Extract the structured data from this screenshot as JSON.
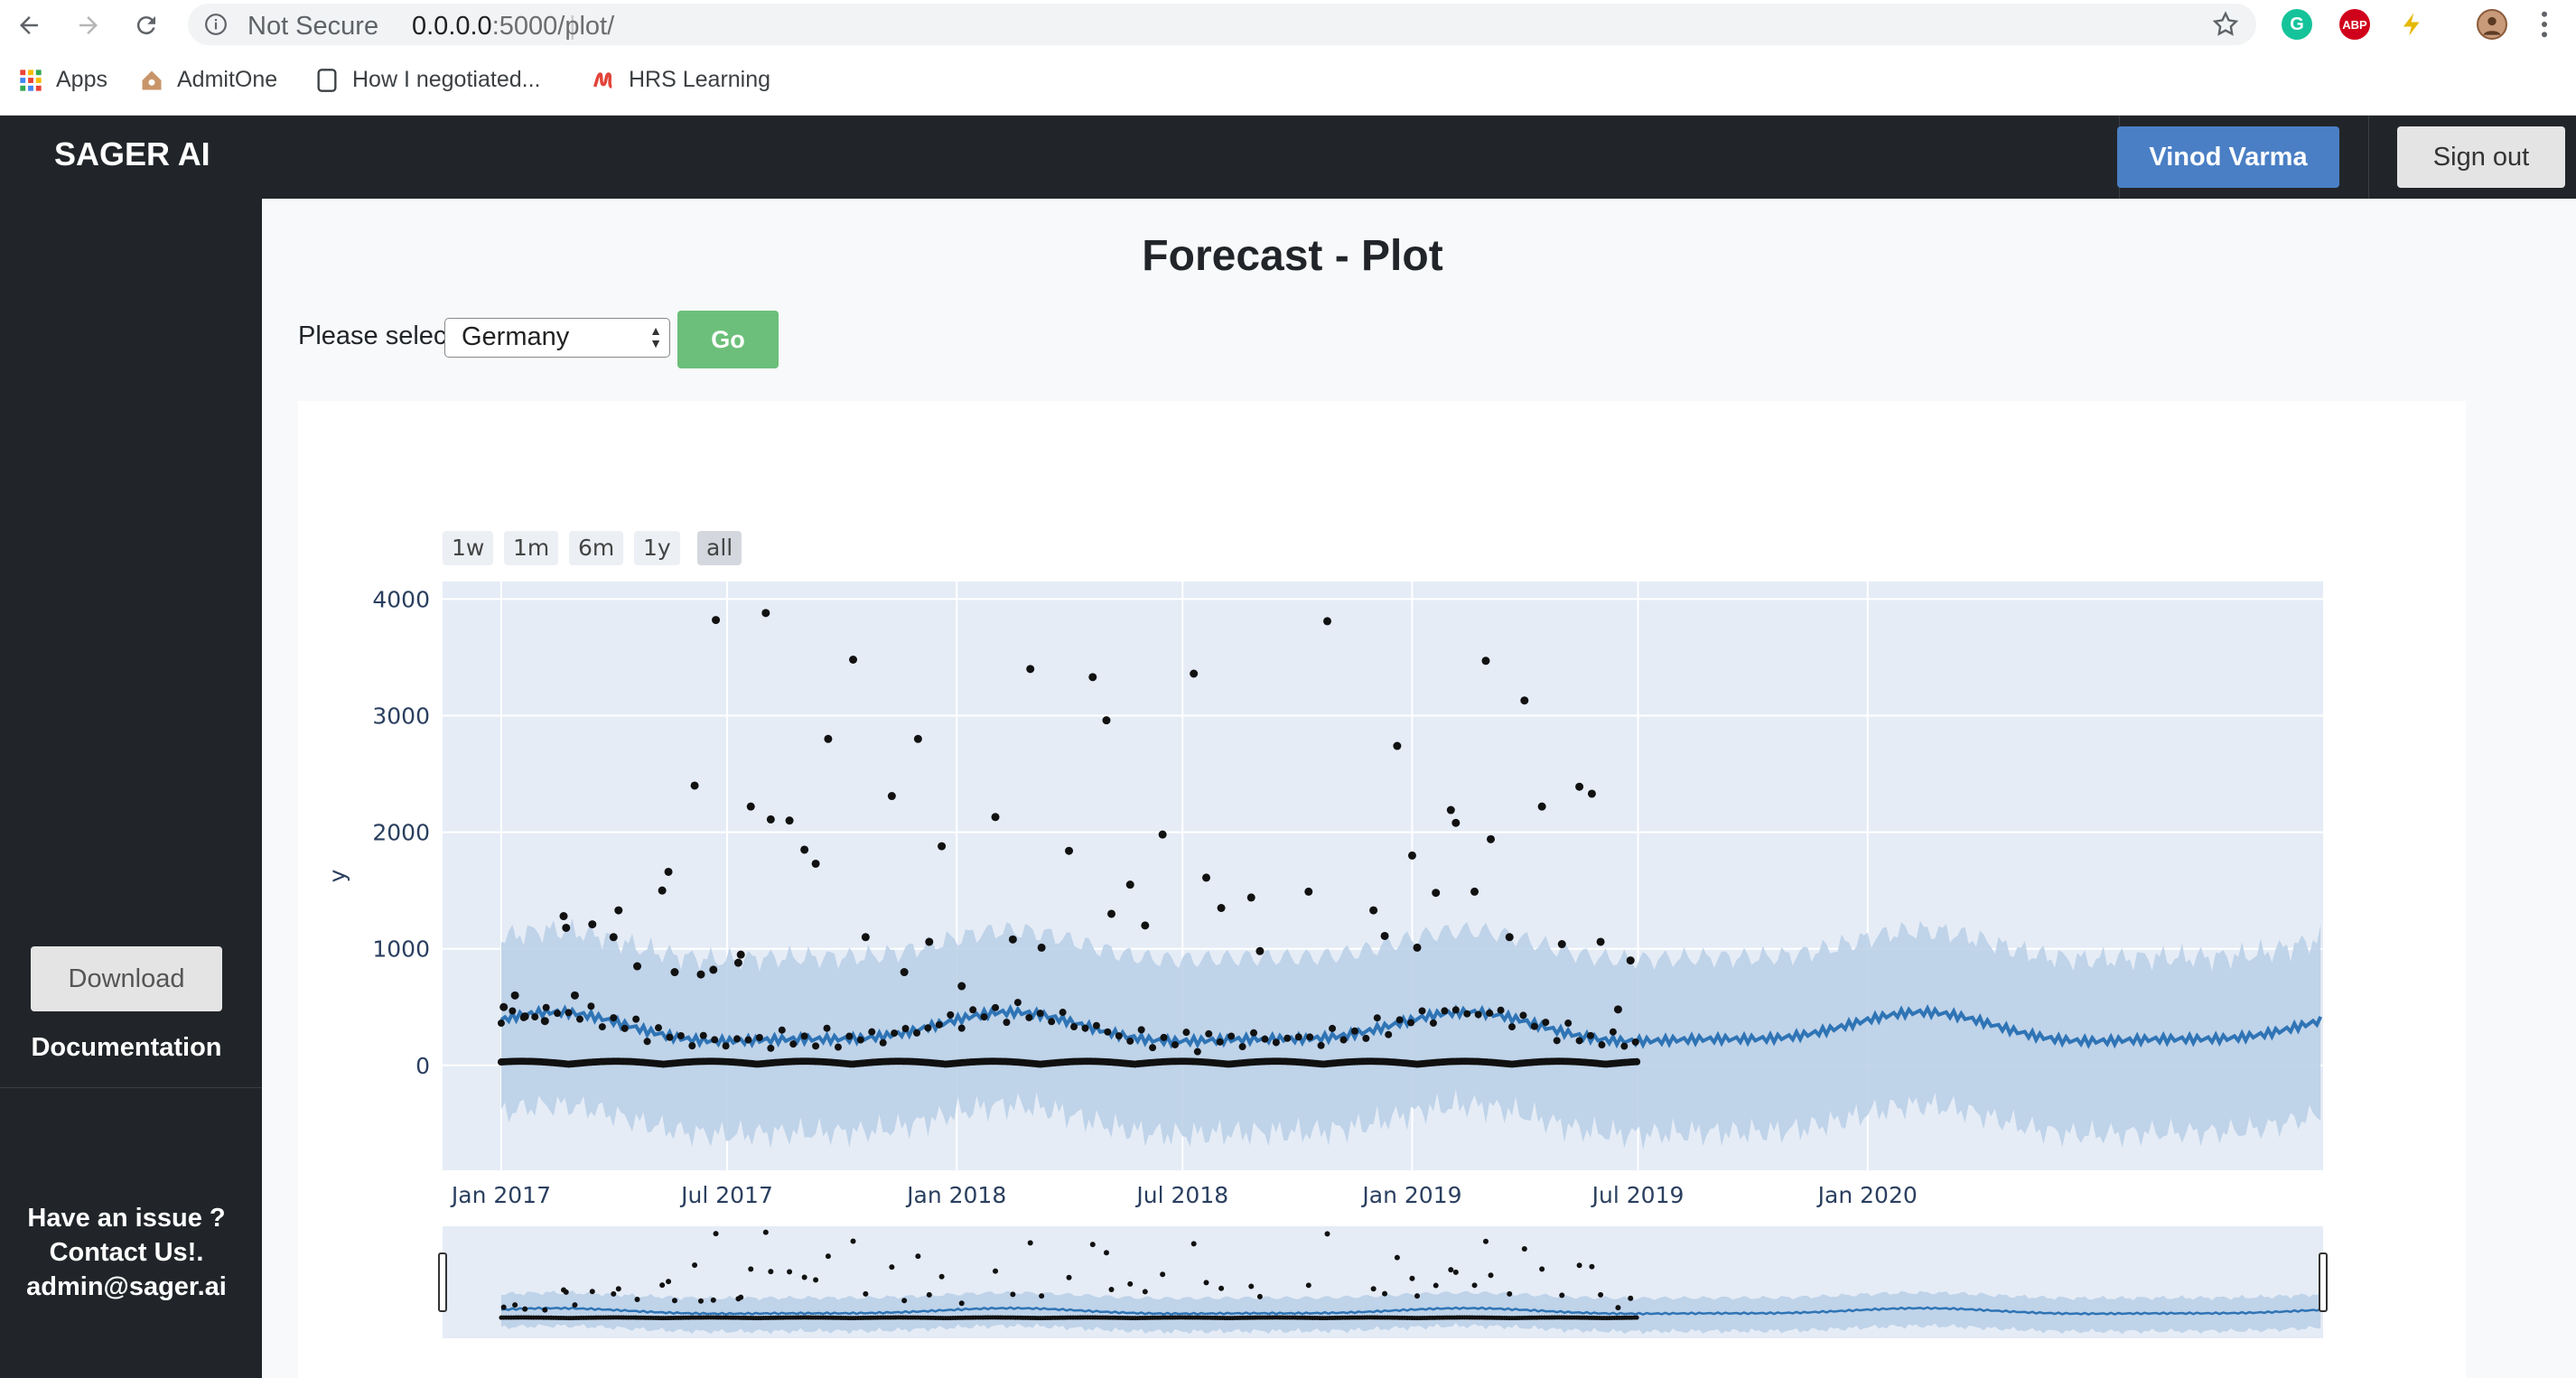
{
  "browser": {
    "security_label": "Not Secure",
    "url_host": "0.0.0.0",
    "url_path": ":5000/plot/",
    "bookmarks": [
      "Apps",
      "AdmitOne",
      "How I negotiated...",
      "HRS Learning"
    ],
    "ext_abp": "ABP"
  },
  "header": {
    "brand": "SAGER AI",
    "user_name": "Vinod Varma",
    "signout": "Sign out"
  },
  "sidebar": {
    "download": "Download",
    "documentation": "Documentation",
    "contact_line1": "Have an issue ?",
    "contact_line2": "Contact Us!.",
    "contact_email": "admin@sager.ai"
  },
  "main": {
    "title": "Forecast - Plot",
    "select_label": "Please select",
    "selected_country": "Germany",
    "go": "Go"
  },
  "chart_data": {
    "type": "scatter",
    "ylabel": "y",
    "ylim": [
      -900,
      4150
    ],
    "xlim": [
      "2016-11-15",
      "2020-12-31"
    ],
    "x_ticks": [
      "Jan 2017",
      "Jul 2017",
      "Jan 2018",
      "Jul 2018",
      "Jan 2019",
      "Jul 2019",
      "Jan 2020"
    ],
    "y_ticks": [
      0,
      1000,
      2000,
      3000,
      4000
    ],
    "range_selector": [
      "1w",
      "1m",
      "6m",
      "1y",
      "all"
    ],
    "range_selector_active": "all",
    "grid": true,
    "has_range_slider": true,
    "history_end": "2019-06-30",
    "series": [
      {
        "kind": "actuals",
        "points": [
          [
            "2017-01-03",
            500
          ],
          [
            "2017-01-12",
            600
          ],
          [
            "2017-01-20",
            420
          ],
          [
            "2017-02-05",
            380
          ],
          [
            "2017-02-20",
            1280
          ],
          [
            "2017-02-22",
            1180
          ],
          [
            "2017-03-01",
            600
          ],
          [
            "2017-03-15",
            1210
          ],
          [
            "2017-04-01",
            1100
          ],
          [
            "2017-04-05",
            1330
          ],
          [
            "2017-04-20",
            850
          ],
          [
            "2017-05-10",
            1500
          ],
          [
            "2017-05-15",
            1660
          ],
          [
            "2017-05-20",
            800
          ],
          [
            "2017-06-05",
            2400
          ],
          [
            "2017-06-10",
            780
          ],
          [
            "2017-06-20",
            820
          ],
          [
            "2017-06-22",
            3820
          ],
          [
            "2017-07-10",
            880
          ],
          [
            "2017-07-12",
            950
          ],
          [
            "2017-07-20",
            2220
          ],
          [
            "2017-08-01",
            3880
          ],
          [
            "2017-08-05",
            2110
          ],
          [
            "2017-08-20",
            2100
          ],
          [
            "2017-09-01",
            1850
          ],
          [
            "2017-09-10",
            1730
          ],
          [
            "2017-09-20",
            2800
          ],
          [
            "2017-10-10",
            3480
          ],
          [
            "2017-10-20",
            1100
          ],
          [
            "2017-11-10",
            2310
          ],
          [
            "2017-11-20",
            800
          ],
          [
            "2017-12-01",
            2800
          ],
          [
            "2017-12-10",
            1060
          ],
          [
            "2017-12-20",
            1880
          ],
          [
            "2018-01-05",
            680
          ],
          [
            "2018-02-01",
            2130
          ],
          [
            "2018-02-15",
            1080
          ],
          [
            "2018-03-01",
            3400
          ],
          [
            "2018-03-10",
            1010
          ],
          [
            "2018-04-01",
            1840
          ],
          [
            "2018-04-20",
            3330
          ],
          [
            "2018-05-01",
            2960
          ],
          [
            "2018-05-05",
            1300
          ],
          [
            "2018-05-20",
            1550
          ],
          [
            "2018-06-01",
            1200
          ],
          [
            "2018-06-15",
            1980
          ],
          [
            "2018-07-10",
            3360
          ],
          [
            "2018-07-20",
            1610
          ],
          [
            "2018-08-01",
            1350
          ],
          [
            "2018-08-25",
            1440
          ],
          [
            "2018-09-01",
            980
          ],
          [
            "2018-10-10",
            1490
          ],
          [
            "2018-10-25",
            3810
          ],
          [
            "2018-12-01",
            1330
          ],
          [
            "2018-12-10",
            1110
          ],
          [
            "2018-12-20",
            2740
          ],
          [
            "2019-01-01",
            1800
          ],
          [
            "2019-01-05",
            1010
          ],
          [
            "2019-01-20",
            1480
          ],
          [
            "2019-02-01",
            2190
          ],
          [
            "2019-02-05",
            2080
          ],
          [
            "2019-02-20",
            1490
          ],
          [
            "2019-03-01",
            3470
          ],
          [
            "2019-03-05",
            1940
          ],
          [
            "2019-03-20",
            1100
          ],
          [
            "2019-04-01",
            3130
          ],
          [
            "2019-04-15",
            2220
          ],
          [
            "2019-05-01",
            1040
          ],
          [
            "2019-05-15",
            2390
          ],
          [
            "2019-05-25",
            2330
          ],
          [
            "2019-06-01",
            1060
          ],
          [
            "2019-06-15",
            480
          ],
          [
            "2019-06-25",
            900
          ]
        ]
      },
      {
        "kind": "forecast",
        "mean_level": 300,
        "seasonal_amplitude": 130,
        "weekly_amplitude": 35
      },
      {
        "kind": "uncertainty",
        "upper": 1000,
        "lower": -500
      }
    ]
  }
}
